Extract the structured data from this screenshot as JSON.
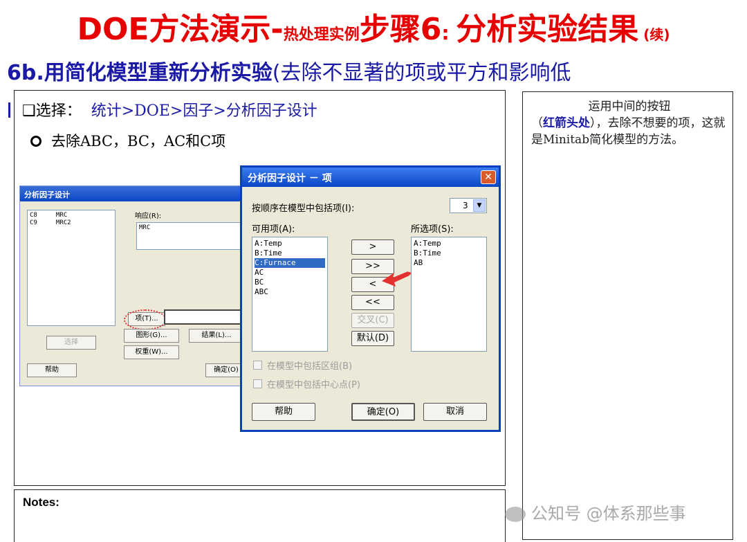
{
  "title": {
    "part1": "DOE方法演示-",
    "part2": "热处理实例",
    "part3": "步骤6",
    "part4": ": ",
    "part5": "分析实验结果",
    "part6": " (续)"
  },
  "subtitle": {
    "bold": "6b.用简化模型重新分析实验",
    "normal": "(去除不显著的项或平方和影响低"
  },
  "instructions": {
    "select_label": "❑选择：",
    "select_path": "统计>DOE>因子>分析因子设计",
    "remove_text": "去除ABC，BC，AC和C项"
  },
  "side_note": {
    "line1": "运用中间的按钮",
    "paren_open": "（",
    "highlight": "红箭头处",
    "rest": "），去除不想要的项，这就是Minitab简化模型的方法。"
  },
  "notes_label": "Notes:",
  "bg_dialog": {
    "title": "分析因子设计",
    "columns": [
      "C8     MRC",
      "C9     MRC2"
    ],
    "response_label": "响应(R):",
    "response_value": "MRC",
    "terms_button": "项(T)...",
    "graphs_button": "图形(G)...",
    "results_button": "结果(L)...",
    "weights_button": "权重(W)...",
    "select_button": "选择",
    "help_button": "帮助",
    "ok_button": "确定(O)"
  },
  "fg_dialog": {
    "title": "分析因子设计 － 项",
    "order_label": "按顺序在模型中包括项(I):",
    "order_value": "3",
    "available_label": "可用项(A):",
    "selected_label": "所选项(S):",
    "available_terms": [
      "A:Temp",
      "B:Time",
      "C:Furnace",
      "AC",
      "BC",
      "ABC"
    ],
    "selected_index": 2,
    "selected_terms": [
      "A:Temp",
      "B:Time",
      "AB"
    ],
    "btn_add": ">",
    "btn_add_all": ">>",
    "btn_remove": "<",
    "btn_remove_all": "<<",
    "btn_cross": "交叉(C)",
    "btn_default": "默认(D)",
    "check_blocks": "在模型中包括区组(B)",
    "check_center": "在模型中包括中心点(P)",
    "help_button": "帮助",
    "ok_button": "确定(O)",
    "cancel_button": "取消",
    "close_icon": "✕"
  },
  "watermark": "公知号 @体系那些事",
  "colors": {
    "title_red": "#e60000",
    "accent_blue": "#1a1aa6",
    "xp_blue": "#0a46c4",
    "arrow_red": "#e53030"
  }
}
